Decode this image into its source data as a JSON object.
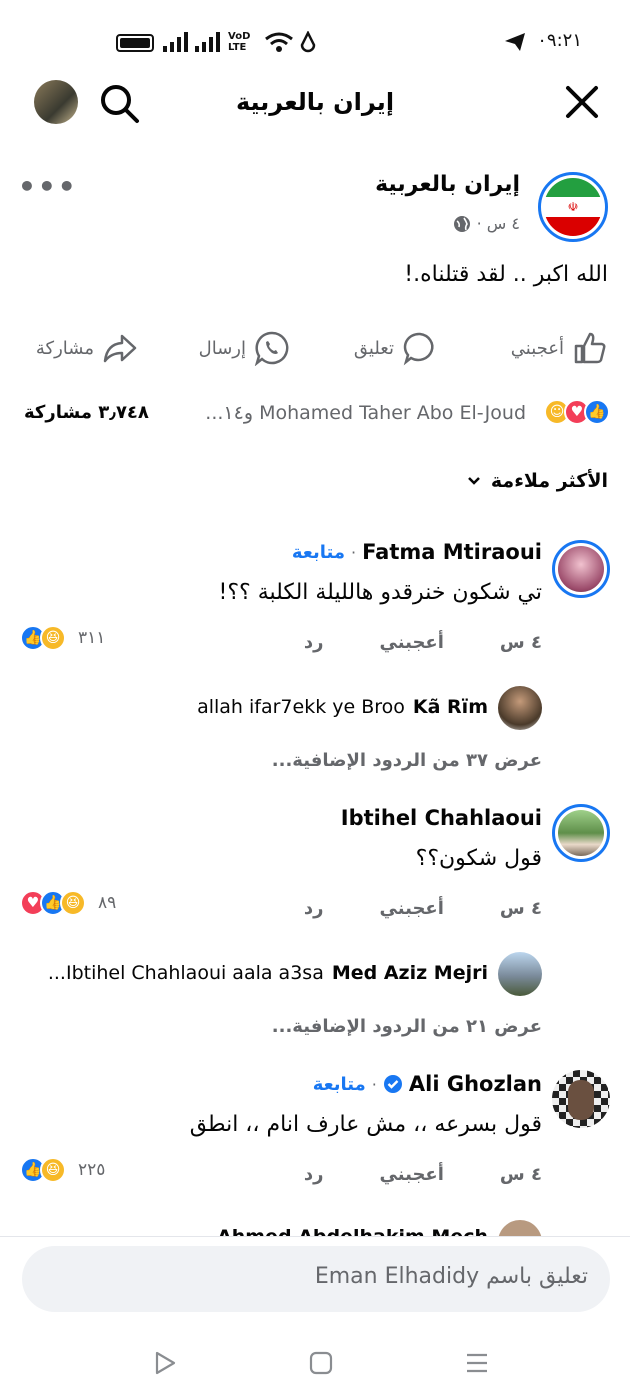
{
  "status_bar": {
    "time": "٠٩:٢١"
  },
  "header": {
    "title": "إيران بالعربية"
  },
  "post": {
    "page_name": "إيران بالعربية",
    "time": "٤ س ·",
    "text": "الله اكبر .. لقد قتلناه.!"
  },
  "actions": {
    "like": "أعجبني",
    "comment": "تعليق",
    "send": "إرسال",
    "share": "مشاركة"
  },
  "reactions_summary": {
    "names": "Mohamed Taher Abo El-Joud و١٤...",
    "shares": "٣٫٧٤٨ مشاركة"
  },
  "sort": {
    "label": "الأكثر ملاءمة"
  },
  "comments": [
    {
      "name": "Fatma Mtiraoui",
      "follow": "متابعة",
      "text": "تي شكون خنرقدو هالليلة الكلبة ؟؟!",
      "time": "٤ س",
      "like": "أعجبني",
      "reply": "رد",
      "reaction_count": "٣١١",
      "reply_preview_name": "Kã Rïm",
      "reply_preview_text": "allah ifar7ekk ye Broo",
      "more_replies": "عرض ٣٧ من الردود الإضافية..."
    },
    {
      "name": "Ibtihel Chahlaoui",
      "text": "قول شكون؟؟",
      "time": "٤ س",
      "like": "أعجبني",
      "reply": "رد",
      "reaction_count": "٨٩",
      "reply_preview_name": "Med Aziz Mejri",
      "reply_preview_text": "Ibtihel Chahlaoui aala a3sa...",
      "more_replies": "عرض ٢١ من الردود الإضافية..."
    },
    {
      "name": "Ali Ghozlan",
      "follow": "متابعة",
      "text": "قول بسرعه ،، مش عارف انام ،، انطق",
      "time": "٤ س",
      "like": "أعجبني",
      "reply": "رد",
      "reaction_count": "٢٢٥",
      "partial_next": "Ahmed Abdelhakim Mech"
    }
  ],
  "composer": {
    "placeholder": "تعليق باسم Eman Elhadidy"
  },
  "colors": {
    "accent": "#1877f2",
    "muted": "#65676b",
    "input_bg": "#f0f2f5"
  }
}
